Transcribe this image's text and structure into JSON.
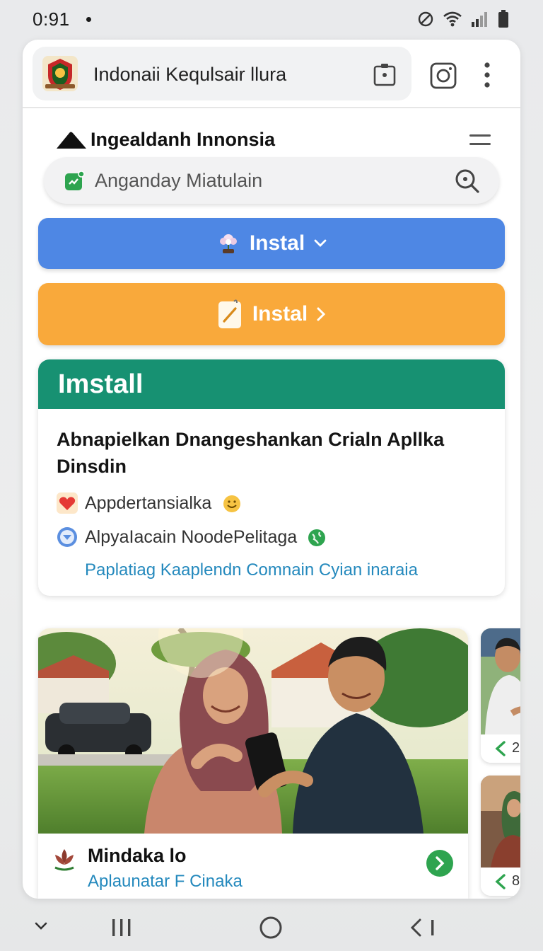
{
  "status_bar": {
    "time": "0:91"
  },
  "browser": {
    "address_text": "Indonaii Kequlsair llura"
  },
  "site": {
    "title": "Ingealdanh Innonsia",
    "search_placeholder": "Anganday Miatulain"
  },
  "buttons": {
    "install_blue": "Instal",
    "install_orange": "Instal"
  },
  "info_card": {
    "header": "Imstall",
    "headline": "Abnapielkan Dnangeshankan Crialn Apllka Dinsdin",
    "features": [
      {
        "icon": "heart-icon",
        "text": "Appdertansialka",
        "badge": "smiley-icon"
      },
      {
        "icon": "chevron-circle-icon",
        "text": "AlpyaIacain NoodePelitaga",
        "badge": "globe-icon"
      }
    ],
    "link": "Paplatiag Kaaplendn Comnain Cyian inaraia"
  },
  "feature_card": {
    "title": "Mindaka lo",
    "subtitle": "Aplaunatar F Cinaka"
  },
  "side_cards": [
    {
      "label": "2"
    },
    {
      "label": "8"
    }
  ],
  "colors": {
    "blue_button": "#4e87e4",
    "orange_button": "#f9a93b",
    "green_header": "#179172",
    "link": "#2489bd"
  }
}
